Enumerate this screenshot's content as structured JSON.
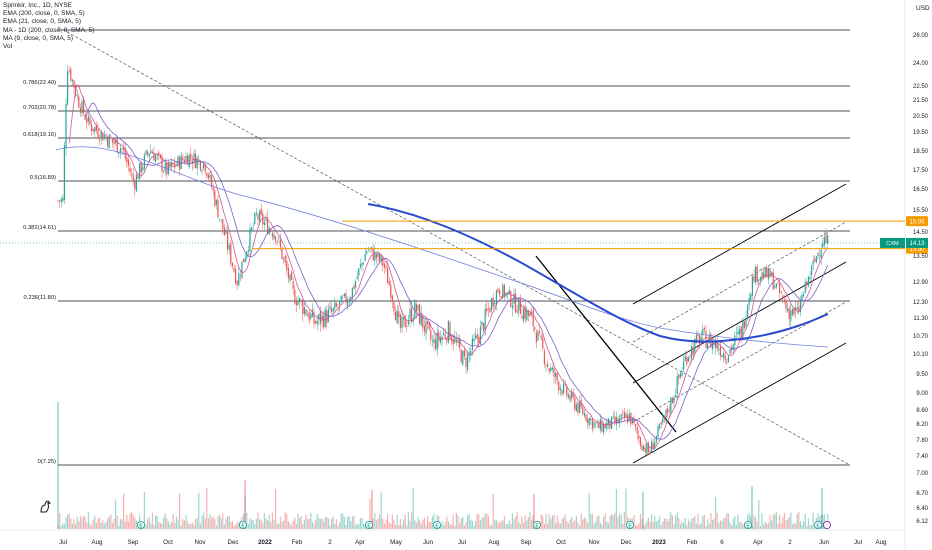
{
  "legend": {
    "symbol": "Sprinklr, Inc., 1D, NYSE",
    "ind1": "EMA (200, close, 0, SMA, 5)",
    "ind2": "EMA (21, close, 0, SMA, 5)",
    "ind3": "MA - 1D (200, close, 0, SMA, 5)",
    "ind4": "MA (9, close, 0, SMA, 5)",
    "ind5": "Vol"
  },
  "colors": {
    "up": "#26a69a",
    "down": "#ef5350",
    "ema200": "#2a4ad0",
    "ema21": "#7b61c8",
    "ma200": "#6f7fe0",
    "ma9": "#d05a9a",
    "fib": "#131722",
    "level": "#f59b00",
    "price_badge": "#089981"
  },
  "chart_data": {
    "type": "candlestick",
    "title": "Sprinklr, Inc., 1D, NYSE",
    "currency": "USD",
    "ylim": [
      6.0,
      27.5
    ],
    "y_axis_ticks": [
      "26.00",
      "24.00",
      "22.50",
      "21.50",
      "20.50",
      "19.50",
      "18.50",
      "17.50",
      "16.50",
      "15.50",
      "14.50",
      "13.50",
      "12.90",
      "12.30",
      "11.30",
      "10.70",
      "10.10",
      "9.50",
      "9.00",
      "8.60",
      "8.20",
      "7.80",
      "7.40",
      "7.00",
      "6.70",
      "6.40",
      "6.12"
    ],
    "x_axis_labels": [
      "Jul",
      "Aug",
      "Sep",
      "Oct",
      "Nov",
      "Dec",
      "2022",
      "Feb",
      "2",
      "Apr",
      "May",
      "Jun",
      "Jul",
      "Aug",
      "Sep",
      "Oct",
      "Nov",
      "Dec",
      "2023",
      "Feb",
      "6",
      "Apr",
      "2",
      "Jun",
      "Jul",
      "Aug"
    ],
    "fib_levels": [
      {
        "label": "0(7.25)",
        "value": 7.25
      },
      {
        "label": "0.236(11.80)",
        "value": 11.8
      },
      {
        "label": "0.382(14.61)",
        "value": 14.61
      },
      {
        "label": "0.5(16.89)",
        "value": 16.89
      },
      {
        "label": "0.618(19.16)",
        "value": 19.16
      },
      {
        "label": "0.702(20.78)",
        "value": 20.78
      },
      {
        "label": "0.786(22.40)",
        "value": 22.4
      },
      {
        "label": "",
        "value": 26.5
      }
    ],
    "horizontal_levels": [
      {
        "label": "15.06",
        "value": 15.06
      },
      {
        "label": "13.90",
        "value": 13.9
      }
    ],
    "last_price": {
      "symbol": "CXM",
      "value": "14.13"
    },
    "close_series": [
      {
        "x": "2021-07-01",
        "y": 16.0
      },
      {
        "x": "2021-07-05",
        "y": 24.0
      },
      {
        "x": "2021-07-15",
        "y": 21.5
      },
      {
        "x": "2021-07-25",
        "y": 20.0
      },
      {
        "x": "2021-08-10",
        "y": 19.2
      },
      {
        "x": "2021-08-25",
        "y": 18.6
      },
      {
        "x": "2021-09-05",
        "y": 16.8
      },
      {
        "x": "2021-09-20",
        "y": 18.6
      },
      {
        "x": "2021-10-05",
        "y": 17.4
      },
      {
        "x": "2021-10-25",
        "y": 18.2
      },
      {
        "x": "2021-11-10",
        "y": 17.8
      },
      {
        "x": "2021-11-25",
        "y": 15.0
      },
      {
        "x": "2021-12-10",
        "y": 12.6
      },
      {
        "x": "2021-12-28",
        "y": 15.3
      },
      {
        "x": "2022-01-15",
        "y": 14.5
      },
      {
        "x": "2022-02-01",
        "y": 12.0
      },
      {
        "x": "2022-02-20",
        "y": 11.2
      },
      {
        "x": "2022-03-10",
        "y": 11.5
      },
      {
        "x": "2022-03-25",
        "y": 12.0
      },
      {
        "x": "2022-04-10",
        "y": 13.9
      },
      {
        "x": "2022-04-25",
        "y": 13.3
      },
      {
        "x": "2022-05-10",
        "y": 11.0
      },
      {
        "x": "2022-05-25",
        "y": 11.6
      },
      {
        "x": "2022-06-10",
        "y": 10.6
      },
      {
        "x": "2022-06-25",
        "y": 11.0
      },
      {
        "x": "2022-07-10",
        "y": 10.1
      },
      {
        "x": "2022-07-25",
        "y": 11.0
      },
      {
        "x": "2022-08-10",
        "y": 12.3
      },
      {
        "x": "2022-08-25",
        "y": 11.8
      },
      {
        "x": "2022-09-10",
        "y": 11.3
      },
      {
        "x": "2022-09-25",
        "y": 10.0
      },
      {
        "x": "2022-10-10",
        "y": 9.3
      },
      {
        "x": "2022-10-25",
        "y": 8.8
      },
      {
        "x": "2022-11-10",
        "y": 8.3
      },
      {
        "x": "2022-11-25",
        "y": 8.4
      },
      {
        "x": "2022-12-10",
        "y": 8.6
      },
      {
        "x": "2022-12-20",
        "y": 7.9
      },
      {
        "x": "2022-12-28",
        "y": 7.6
      },
      {
        "x": "2023-01-10",
        "y": 8.4
      },
      {
        "x": "2023-01-20",
        "y": 9.2
      },
      {
        "x": "2023-02-01",
        "y": 10.3
      },
      {
        "x": "2023-02-15",
        "y": 10.8
      },
      {
        "x": "2023-03-01",
        "y": 10.6
      },
      {
        "x": "2023-03-10",
        "y": 10.3
      },
      {
        "x": "2023-03-25",
        "y": 11.0
      },
      {
        "x": "2023-04-05",
        "y": 12.9
      },
      {
        "x": "2023-04-20",
        "y": 12.8
      },
      {
        "x": "2023-05-05",
        "y": 11.6
      },
      {
        "x": "2023-05-15",
        "y": 11.4
      },
      {
        "x": "2023-05-25",
        "y": 12.6
      },
      {
        "x": "2023-06-02",
        "y": 13.6
      },
      {
        "x": "2023-06-08",
        "y": 14.3
      },
      {
        "x": "2023-06-12",
        "y": 14.13
      }
    ]
  }
}
